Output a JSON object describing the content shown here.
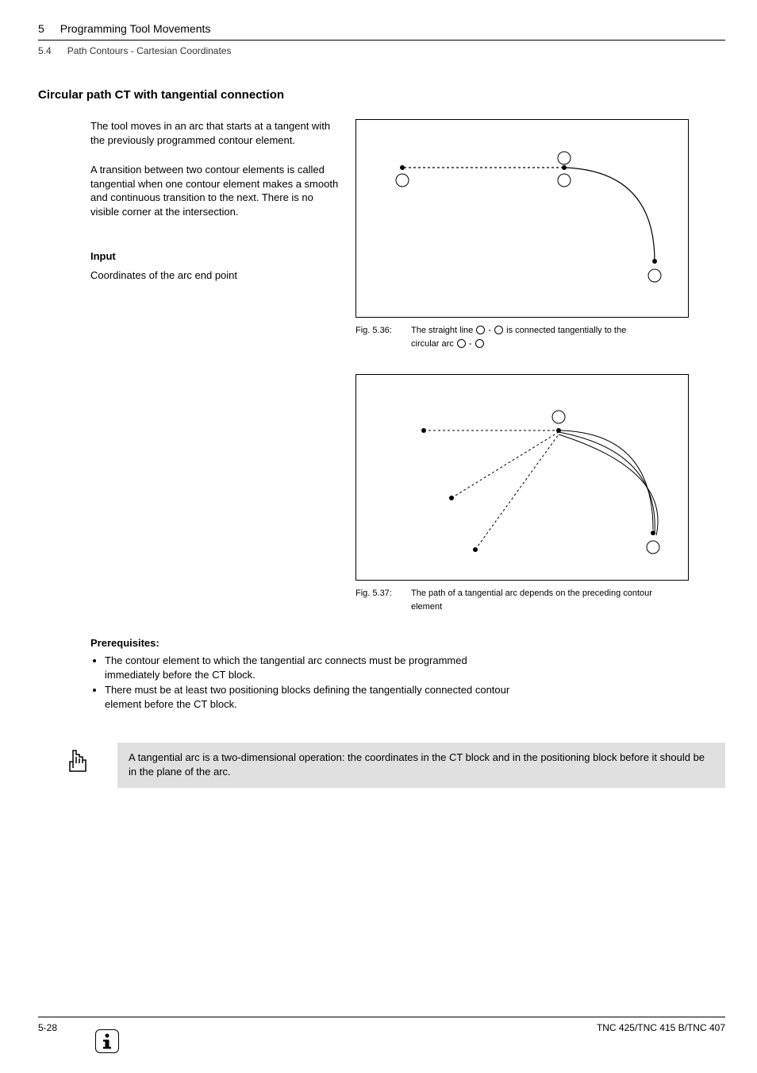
{
  "header": {
    "chapter_num": "5",
    "chapter_title": "Programming Tool Movements",
    "section_num": "5.4",
    "section_title": "Path Contours - Cartesian Coordinates"
  },
  "main": {
    "heading": "Circular path CT with tangential connection",
    "para1": "The tool moves in an arc that starts at a tangent with the previously programmed contour element.",
    "para2": "A transition between two contour elements is called tangential when one contour element makes a smooth and continuous transition to the next. There is no visible corner at the intersection.",
    "input_head": "Input",
    "input_text": "Coordinates of the arc end point",
    "fig1": {
      "num": "Fig. 5.36:",
      "text1": "The straight line ",
      "dash": " - ",
      "text2": " is connected tangentially to the",
      "line2a": "circular arc ",
      "line2dash": " - "
    },
    "fig2": {
      "num": "Fig. 5.37:",
      "text1": "The path of a tangential arc depends on the preceding contour",
      "line2": "element"
    },
    "prereq_head": "Prerequisites:",
    "prereq_items": [
      "The contour element to which the tangential arc connects must be programmed immediately before the CT block.",
      "There must be at least two positioning blocks defining the tangentially connected contour element before the CT block."
    ],
    "note": "A tangential arc is a two-dimensional operation: the coordinates in the CT block and in the positioning block before it should be in the plane of the arc."
  },
  "footer": {
    "left": "5-28",
    "right": "TNC 425/TNC 415 B/TNC 407"
  }
}
